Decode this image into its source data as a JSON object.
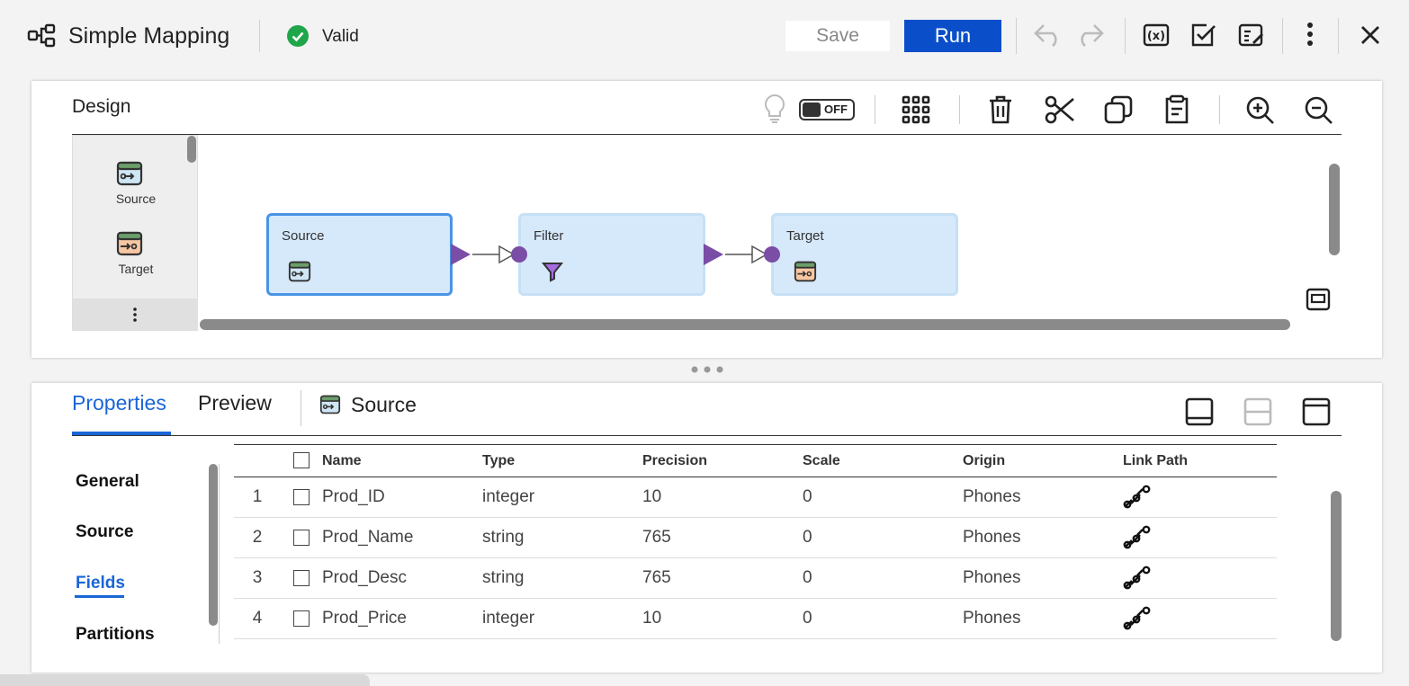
{
  "header": {
    "title": "Simple Mapping",
    "status": "Valid",
    "save_label": "Save",
    "run_label": "Run"
  },
  "design": {
    "title": "Design",
    "toggle_label": "OFF",
    "palette": [
      {
        "label": "Source",
        "icon": "source-icon"
      },
      {
        "label": "Target",
        "icon": "target-icon"
      }
    ],
    "nodes": [
      {
        "title": "Source",
        "icon": "source-icon",
        "selected": true
      },
      {
        "title": "Filter",
        "icon": "filter-icon",
        "selected": false
      },
      {
        "title": "Target",
        "icon": "target-icon",
        "selected": false
      }
    ]
  },
  "properties": {
    "tabs": [
      "Properties",
      "Preview"
    ],
    "active_tab": "Properties",
    "object_label": "Source",
    "side_items": [
      "General",
      "Source",
      "Fields",
      "Partitions"
    ],
    "active_side_item": "Fields",
    "columns": [
      "Name",
      "Type",
      "Precision",
      "Scale",
      "Origin",
      "Link Path"
    ],
    "rows": [
      {
        "num": "1",
        "name": "Prod_ID",
        "type": "integer",
        "precision": "10",
        "scale": "0",
        "origin": "Phones"
      },
      {
        "num": "2",
        "name": "Prod_Name",
        "type": "string",
        "precision": "765",
        "scale": "0",
        "origin": "Phones"
      },
      {
        "num": "3",
        "name": "Prod_Desc",
        "type": "string",
        "precision": "765",
        "scale": "0",
        "origin": "Phones"
      },
      {
        "num": "4",
        "name": "Prod_Price",
        "type": "integer",
        "precision": "10",
        "scale": "0",
        "origin": "Phones"
      }
    ]
  },
  "colors": {
    "accent": "#1a66d6",
    "run_button": "#0a4fc9",
    "valid": "#1fa64a",
    "node_fill": "#d6e9fb",
    "node_selected_border": "#4a94e4",
    "link_purple": "#7a4da6"
  }
}
